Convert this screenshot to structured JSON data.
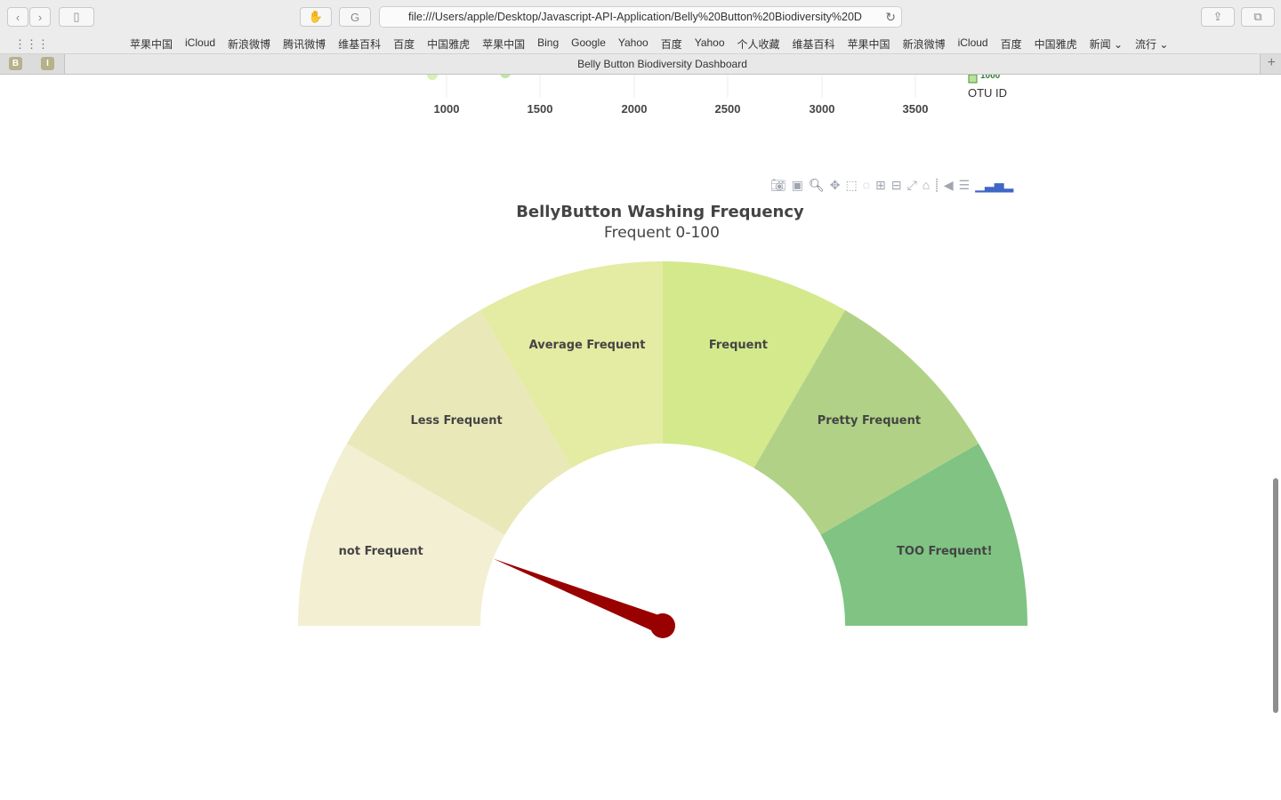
{
  "browser": {
    "url": "file:///Users/apple/Desktop/Javascript-API-Application/Belly%20Button%20Biodiversity%20D",
    "tab_title": "Belly Button Biodiversity Dashboard",
    "pinned_tabs": [
      "B",
      "I"
    ],
    "favorites": [
      "苹果中国",
      "iCloud",
      "新浪微博",
      "腾讯微博",
      "维基百科",
      "百度",
      "中国雅虎",
      "苹果中国",
      "Bing",
      "Google",
      "Yahoo",
      "百度",
      "Yahoo",
      "个人收藏",
      "维基百科",
      "苹果中国",
      "新浪微博",
      "iCloud",
      "百度",
      "中国雅虎",
      "新闻 ⌄",
      "流行 ⌄"
    ]
  },
  "bubble_chart_partial": {
    "x_ticks": [
      "1000",
      "1500",
      "2000",
      "2500",
      "3000",
      "3500"
    ],
    "legend_value": "1000",
    "legend_title": "OTU ID"
  },
  "modebar": {
    "icons": [
      "camera-icon",
      "save-icon",
      "zoom-icon",
      "pan-icon",
      "box-select-icon",
      "lasso-icon",
      "zoom-in-icon",
      "zoom-out-icon",
      "autoscale-icon",
      "reset-axes-icon",
      "spike-lines-icon",
      "hover-closest-icon",
      "hover-compare-icon",
      "plotly-logo-icon"
    ]
  },
  "chart_data": {
    "type": "gauge",
    "title": "BellyButton Washing Frequency",
    "subtitle": "Frequent 0-100",
    "range": [
      0,
      100
    ],
    "segments": [
      {
        "label": "not Frequent",
        "color": "#f3efd3"
      },
      {
        "label": "Less Frequent",
        "color": "#e9e8b9"
      },
      {
        "label": "Average Frequent",
        "color": "#e4eba2"
      },
      {
        "label": "Frequent",
        "color": "#d4e98c"
      },
      {
        "label": "Pretty Frequent",
        "color": "#b1d286"
      },
      {
        "label": "TOO Frequent!",
        "color": "#80c383"
      }
    ],
    "needle_value": 12,
    "needle_color": "#990000"
  }
}
